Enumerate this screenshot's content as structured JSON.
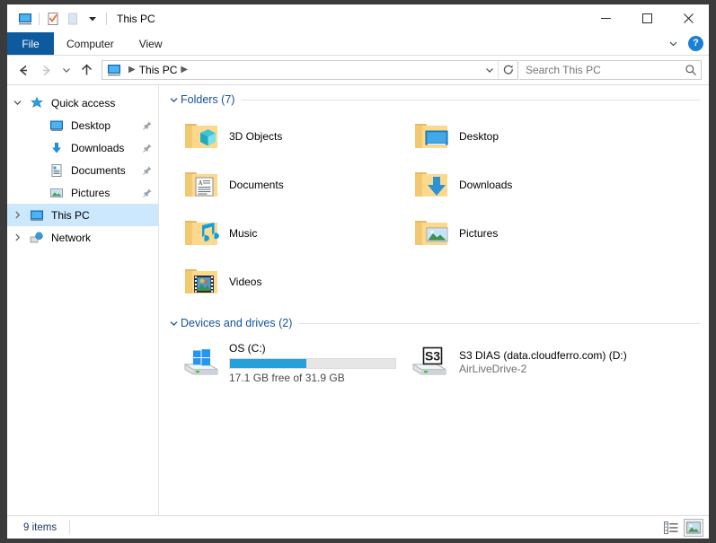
{
  "window": {
    "title": "This PC",
    "quick_access_toolbar": [
      {
        "name": "this-pc-icon",
        "label": "This PC"
      },
      {
        "name": "properties-icon",
        "label": "Properties"
      },
      {
        "name": "new-folder-icon",
        "label": "New folder"
      },
      {
        "name": "customize-dropdown-icon",
        "label": "Customize Quick Access Toolbar"
      }
    ],
    "controls": {
      "minimize": "Minimize",
      "maximize": "Maximize",
      "close": "Close"
    }
  },
  "ribbon": {
    "tabs": [
      {
        "label": "File",
        "active": true
      },
      {
        "label": "Computer",
        "active": false
      },
      {
        "label": "View",
        "active": false
      }
    ],
    "expand_label": "Expand the Ribbon",
    "help_label": "?"
  },
  "address": {
    "back": "Back",
    "forward": "Forward",
    "recent": "Recent locations",
    "up": "Up one level",
    "breadcrumb": [
      {
        "label": "This PC"
      }
    ],
    "dropdown": "Previous locations",
    "refresh": "Refresh This PC"
  },
  "search": {
    "placeholder": "Search This PC",
    "value": ""
  },
  "sidebar": {
    "items": [
      {
        "label": "Quick access",
        "icon": "star-icon",
        "expanded": true,
        "indent": false,
        "pinned": false,
        "selected": false
      },
      {
        "label": "Desktop",
        "icon": "desktop-icon",
        "indent": true,
        "pinned": true,
        "selected": false
      },
      {
        "label": "Downloads",
        "icon": "downloads-icon",
        "indent": true,
        "pinned": true,
        "selected": false
      },
      {
        "label": "Documents",
        "icon": "documents-icon",
        "indent": true,
        "pinned": true,
        "selected": false
      },
      {
        "label": "Pictures",
        "icon": "pictures-icon",
        "indent": true,
        "pinned": true,
        "selected": false
      },
      {
        "label": "This PC",
        "icon": "this-pc-icon",
        "expanded": false,
        "indent": false,
        "pinned": false,
        "selected": true
      },
      {
        "label": "Network",
        "icon": "network-icon",
        "expanded": false,
        "indent": false,
        "pinned": false,
        "selected": false
      }
    ]
  },
  "main": {
    "groups": [
      {
        "title": "Folders (7)",
        "expanded": true,
        "items": [
          {
            "label": "3D Objects",
            "icon": "folder-3d-objects-icon"
          },
          {
            "label": "Desktop",
            "icon": "folder-desktop-icon"
          },
          {
            "label": "Documents",
            "icon": "folder-documents-icon"
          },
          {
            "label": "Downloads",
            "icon": "folder-downloads-icon"
          },
          {
            "label": "Music",
            "icon": "folder-music-icon"
          },
          {
            "label": "Pictures",
            "icon": "folder-pictures-icon"
          },
          {
            "label": "Videos",
            "icon": "folder-videos-icon"
          }
        ]
      }
    ],
    "drives_group": {
      "title": "Devices and drives (2)",
      "expanded": true,
      "drives": [
        {
          "name": "OS (C:)",
          "icon": "windows-drive-icon",
          "has_bar": true,
          "free_text": "17.1 GB free of 31.9 GB",
          "used_percent": 46,
          "bar_color": "#26a0da"
        },
        {
          "name": "S3 DIAS (data.cloudferro.com) (D:)",
          "icon": "s3-drive-icon",
          "badge": "S3",
          "has_bar": false,
          "subtitle": "AirLiveDrive-2"
        }
      ]
    }
  },
  "statusbar": {
    "item_count": "9 items",
    "views": [
      {
        "name": "details-view-button",
        "label": "Details view",
        "active": false
      },
      {
        "name": "large-icons-view-button",
        "label": "Large icons view",
        "active": true
      }
    ]
  },
  "colors": {
    "accent": "#0d5a9e",
    "group_header": "#13519c",
    "selection": "#cce8ff",
    "hover": "#e5f3fb",
    "progress": "#26a0da",
    "folder": "#ffd98a"
  }
}
